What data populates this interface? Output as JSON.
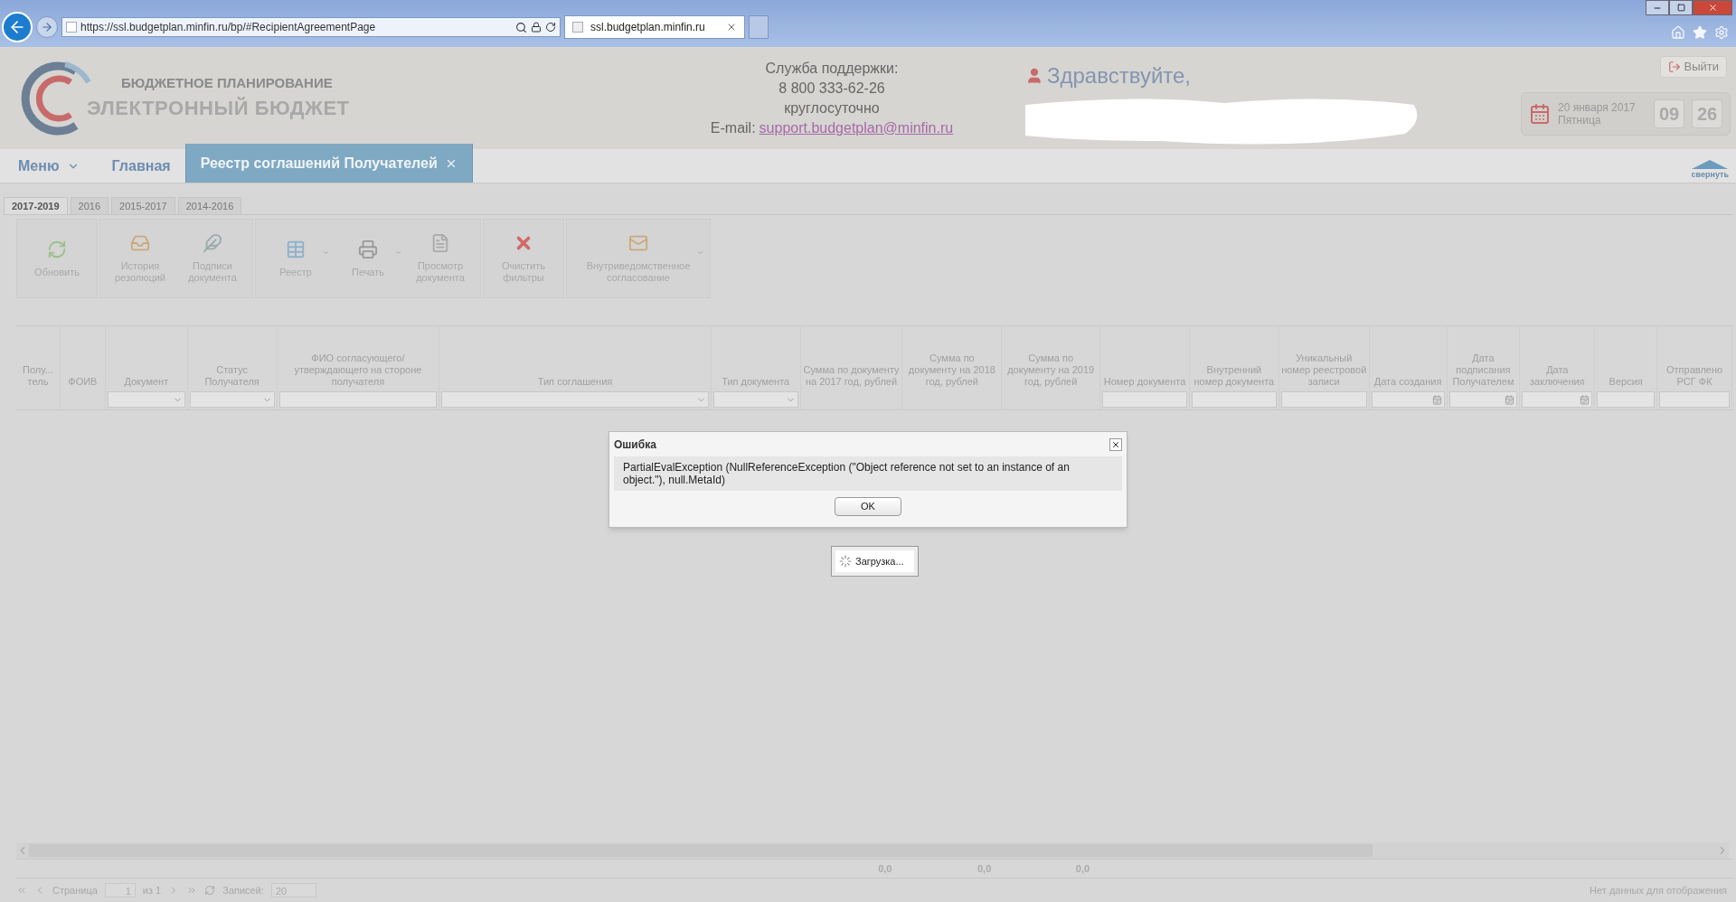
{
  "browser": {
    "url": "https://ssl.budgetplan.minfin.ru/bp/#RecipientAgreementPage",
    "tab": "ssl.budgetplan.minfin.ru"
  },
  "header": {
    "logo_top": "БЮДЖЕТНОЕ ПЛАНИРОВАНИЕ",
    "logo_bottom": "ЭЛЕКТРОННЫЙ БЮДЖЕТ",
    "support": [
      "Служба поддержки:",
      "8 800 333-62-26",
      "круглосуточно"
    ],
    "email_label": "E-mail:",
    "email": "support.budgetplan@minfin.ru",
    "greeting": "Здравствуйте,",
    "logout": "Выйти",
    "date": "20 января 2017",
    "weekday": "Пятница",
    "hours": "09",
    "minutes": "26"
  },
  "nav": {
    "menu": "Меню",
    "items": [
      {
        "label": "Главная",
        "selected": false,
        "closable": false
      },
      {
        "label": "Реестр соглашений Получателей",
        "selected": true,
        "closable": true
      }
    ],
    "collapse": "свернуть"
  },
  "year_tabs": [
    {
      "label": "2017-2019",
      "selected": true
    },
    {
      "label": "2016",
      "selected": false
    },
    {
      "label": "2015-2017",
      "selected": false
    },
    {
      "label": "2014-2016",
      "selected": false
    }
  ],
  "toolbar": [
    [
      {
        "label": "Обновить",
        "dropdown": false
      }
    ],
    [
      {
        "label": "История резолюций",
        "dropdown": false
      },
      {
        "label": "Подписи документа",
        "dropdown": false
      }
    ],
    [
      {
        "label": "Реестр",
        "dropdown": true
      },
      {
        "label": "Печать",
        "dropdown": true
      },
      {
        "label": "Просмотр документа",
        "dropdown": false
      }
    ],
    [
      {
        "label": "Очистить фильтры",
        "dropdown": false
      }
    ],
    [
      {
        "label": "Внутриведомственное согласование",
        "dropdown": true
      }
    ]
  ],
  "grid": {
    "columns": [
      {
        "title": "Полу... тель"
      },
      {
        "title": "ФОИВ"
      },
      {
        "title": "Документ",
        "kind": "combo"
      },
      {
        "title": "Статус Получателя",
        "kind": "combo"
      },
      {
        "title": "ФИО согласующего/утверждающего на стороне получателя",
        "kind": "text"
      },
      {
        "title": "Тип соглашения",
        "kind": "combo"
      },
      {
        "title": "Тип документа",
        "kind": "combo"
      },
      {
        "title": "Сумма по документу на 2017 год, рублей",
        "total": "0,0"
      },
      {
        "title": "Сумма по документу на 2018 год, рублей",
        "total": "0,0"
      },
      {
        "title": "Сумма по документу на 2019 год, рублей",
        "total": "0,0"
      },
      {
        "title": "Номер документа",
        "kind": "text"
      },
      {
        "title": "Внутренний номер документа",
        "kind": "text"
      },
      {
        "title": "Уникальный номер реестровой записи",
        "kind": "text"
      },
      {
        "title": "Дата создания",
        "kind": "date"
      },
      {
        "title": "Дата подписания Получателем",
        "kind": "date"
      },
      {
        "title": "Дата заключения",
        "kind": "date"
      },
      {
        "title": "Версия",
        "kind": "text"
      },
      {
        "title": "Отправлено РСГ ФК",
        "kind": "text"
      }
    ]
  },
  "dialog": {
    "title": "Ошибка",
    "message": "PartialEvalException (NullReferenceException (\"Object reference not set to an instance of an object.\"), null.MetaId)",
    "button": "OK"
  },
  "loading": "Загрузка...",
  "paging": {
    "page_label": "Страница",
    "page": "1",
    "of": "из 1",
    "records_label": "Записей:",
    "records": "20",
    "empty": "Нет данных для отображения"
  }
}
